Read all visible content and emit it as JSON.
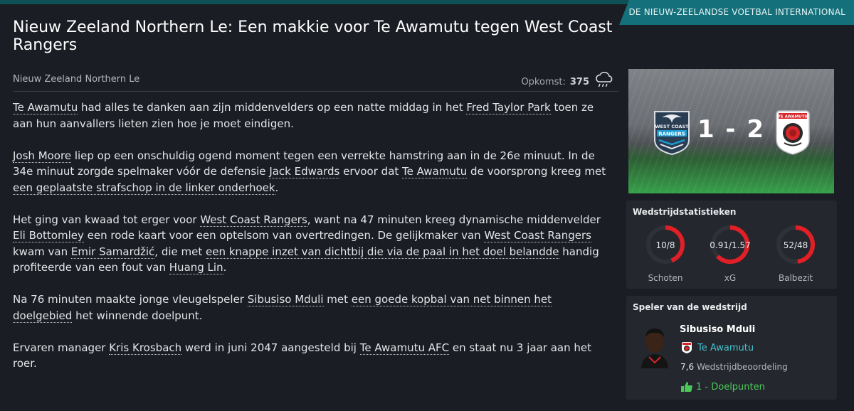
{
  "header": {
    "section_tab": "DE NIEUW-ZEELANDSE VOETBAL INTERNATIONAL",
    "headline": "Nieuw Zeeland Northern Le: Een makkie voor Te Awamutu tegen West Coast Rangers"
  },
  "meta": {
    "competition": "Nieuw Zeeland Northern Le",
    "attendance_label": "Opkomst:",
    "attendance_value": "375",
    "weather_icon": "rain-cloud-icon"
  },
  "article": {
    "p1": {
      "a": "Te Awamutu",
      "b": " had alles te danken aan zijn middenvelders op een natte middag in het ",
      "c": "Fred Taylor Park",
      "d": " toen ze aan hun aanvallers lieten zien hoe je moet eindigen."
    },
    "p2": {
      "a": "Josh Moore",
      "b": " liep op een onschuldig ogend moment tegen een verrekte hamstring aan in de 26e minuut. In de 34e minuut zorgde spelmaker vóór de defensie ",
      "c": "Jack Edwards",
      "d": " ervoor dat ",
      "e": "Te Awamutu",
      "f": " de voorsprong kreeg met ",
      "g": "een geplaatste strafschop in de linker onderhoek",
      "h": "."
    },
    "p3": {
      "a": "Het ging van kwaad tot erger voor ",
      "b": "West Coast Rangers",
      "c": ", want na 47 minuten kreeg dynamische middenvelder ",
      "d": "Eli Bottomley",
      "e": " een rode kaart voor een optelsom van overtredingen. De gelijkmaker van ",
      "f": "West Coast Rangers",
      "g": " kwam van ",
      "h": "Emir Samardžić",
      "i": ", die met ",
      "j": "een knappe inzet van dichtbij die via de paal in het doel belandde",
      "k": " handig profiteerde van een fout van ",
      "l": "Huang Lin",
      "m": "."
    },
    "p4": {
      "a": "Na 76 minuten maakte jonge vleugelspeler ",
      "b": "Sibusiso Mduli",
      "c": " met ",
      "d": "een goede kopbal van net binnen het doelgebied",
      "e": " het winnende doelpunt."
    },
    "p5": {
      "a": "Ervaren manager ",
      "b": "Kris Krosbach",
      "c": " werd in juni 2047 aangesteld bij ",
      "d": "Te Awamutu AFC",
      "e": " en staat nu 3 jaar aan het roer."
    }
  },
  "match": {
    "score": "1 - 2",
    "home_badge_text": [
      "WEST COAST",
      "RANGERS"
    ],
    "away_badge_text": "TE AWAMUTU",
    "home_color": "#1d9bd1",
    "away_color": "#d7262b"
  },
  "stats": {
    "title": "Wedstrijdstatistieken",
    "ring_home_color": "#2e3238",
    "ring_away_color": "#e21f26",
    "items": [
      {
        "value": "10/8",
        "label": "Schoten",
        "away_share": 0.44
      },
      {
        "value": "0.91/1.57",
        "label": "xG",
        "away_share": 0.63
      },
      {
        "value": "52/48",
        "label": "Balbezit",
        "away_share": 0.48
      }
    ]
  },
  "potm": {
    "title": "Speler van de wedstrijd",
    "name": "Sibusiso Mduli",
    "club": "Te Awamutu",
    "rating_value": "7,6",
    "rating_label": "Wedstrijdbeoordeling",
    "goals": "1 - Doelpunten",
    "goals_icon": "thumbs-up-icon"
  }
}
